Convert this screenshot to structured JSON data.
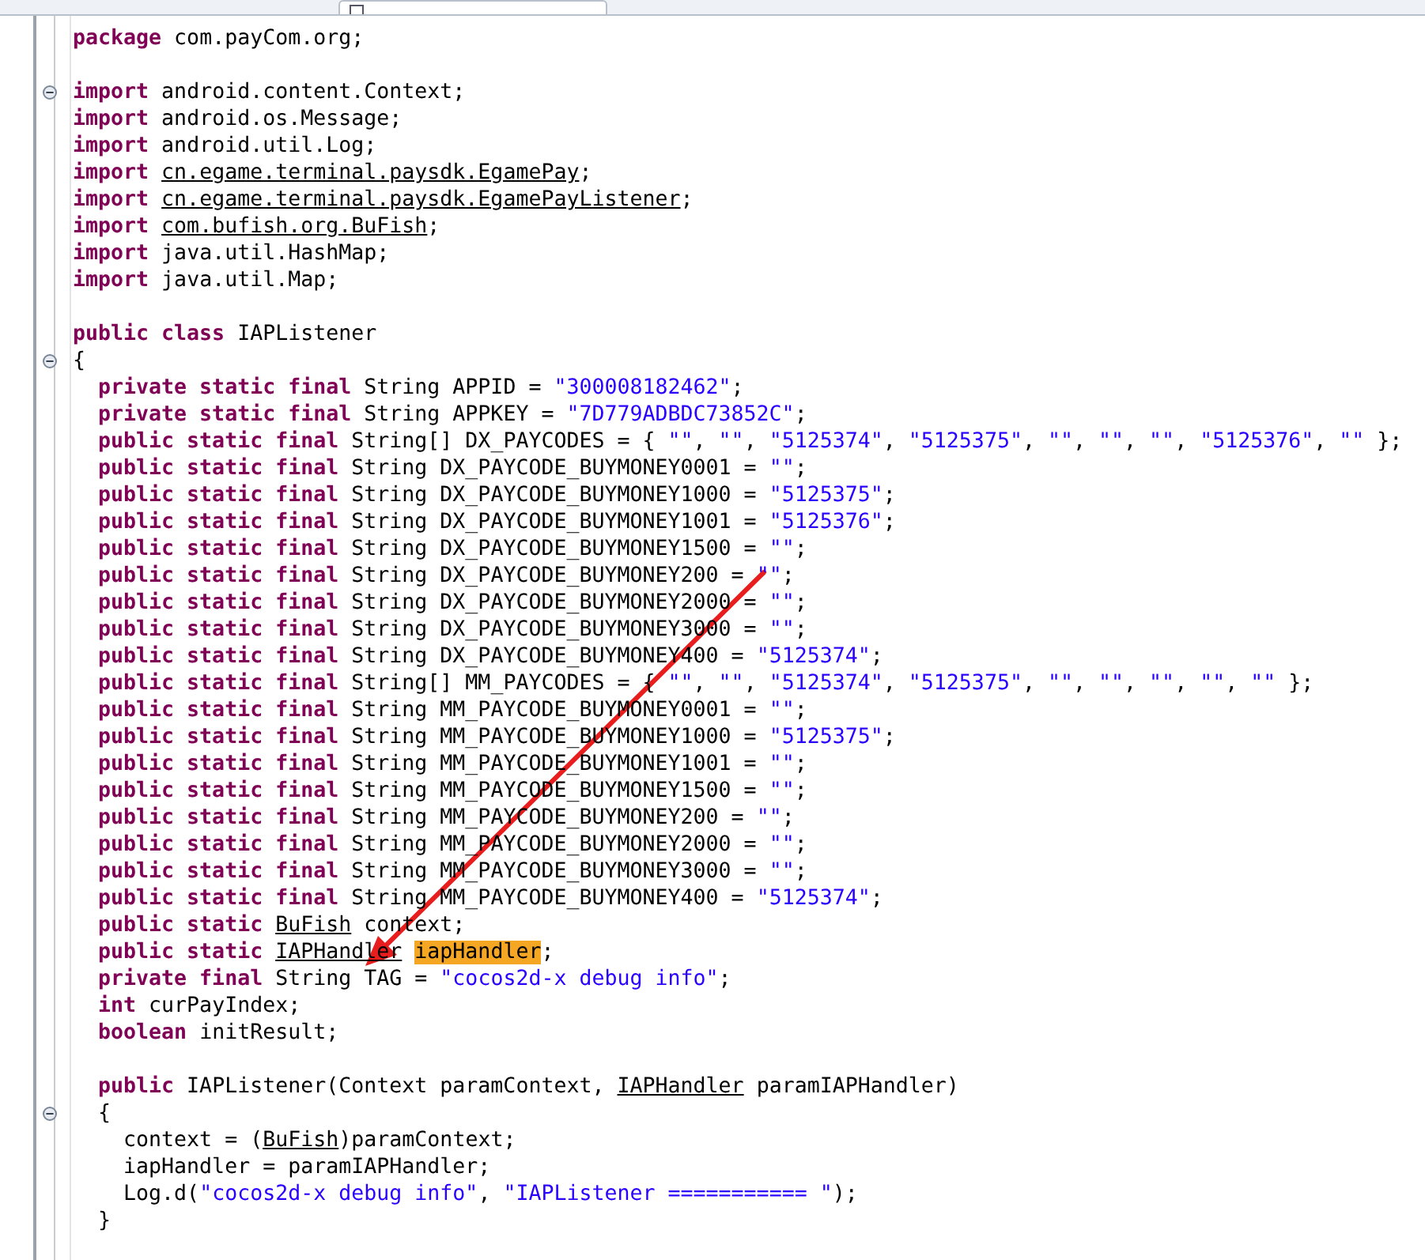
{
  "blocks": [
    [
      {
        "tokens": [
          {
            "kind": "kw",
            "text": "package"
          },
          {
            "kind": "t",
            "text": " com.payCom.org;"
          }
        ]
      }
    ],
    [
      {
        "kind": "fold",
        "expanded": true,
        "tokens": [
          {
            "kind": "kw",
            "text": "import"
          },
          {
            "kind": "t",
            "text": " android.content.Context;"
          }
        ]
      },
      {
        "tokens": [
          {
            "kind": "kw",
            "text": "import"
          },
          {
            "kind": "t",
            "text": " android.os.Message;"
          }
        ]
      },
      {
        "tokens": [
          {
            "kind": "kw",
            "text": "import"
          },
          {
            "kind": "t",
            "text": " android.util.Log;"
          }
        ]
      },
      {
        "tokens": [
          {
            "kind": "kw",
            "text": "import "
          },
          {
            "kind": "u",
            "text": "cn.egame.terminal.paysdk.EgamePay"
          },
          {
            "kind": "t",
            "text": ";"
          }
        ]
      },
      {
        "tokens": [
          {
            "kind": "kw",
            "text": "import "
          },
          {
            "kind": "u",
            "text": "cn.egame.terminal.paysdk.EgamePayListener"
          },
          {
            "kind": "t",
            "text": ";"
          }
        ]
      },
      {
        "tokens": [
          {
            "kind": "kw",
            "text": "import "
          },
          {
            "kind": "u",
            "text": "com.bufish.org.BuFish"
          },
          {
            "kind": "t",
            "text": ";"
          }
        ]
      },
      {
        "tokens": [
          {
            "kind": "kw",
            "text": "import"
          },
          {
            "kind": "t",
            "text": " java.util.HashMap;"
          }
        ]
      },
      {
        "tokens": [
          {
            "kind": "kw",
            "text": "import"
          },
          {
            "kind": "t",
            "text": " java.util.Map;"
          }
        ]
      }
    ],
    [
      {
        "tokens": [
          {
            "kind": "kw",
            "text": "public class"
          },
          {
            "kind": "t",
            "text": " IAPListener"
          }
        ]
      },
      {
        "kind": "fold",
        "expanded": true,
        "tokens": [
          {
            "kind": "t",
            "text": "{"
          }
        ]
      },
      {
        "tokens": [
          {
            "kind": "kw",
            "text": "  private static final"
          },
          {
            "kind": "t",
            "text": " String APPID = "
          },
          {
            "kind": "s",
            "text": "\"300008182462\""
          },
          {
            "kind": "t",
            "text": ";"
          }
        ]
      },
      {
        "tokens": [
          {
            "kind": "kw",
            "text": "  private static final"
          },
          {
            "kind": "t",
            "text": " String APPKEY = "
          },
          {
            "kind": "s",
            "text": "\"7D779ADBDC73852C\""
          },
          {
            "kind": "t",
            "text": ";"
          }
        ]
      },
      {
        "tokens": [
          {
            "kind": "kw",
            "text": "  public static final"
          },
          {
            "kind": "t",
            "text": " String[] DX_PAYCODES = { "
          },
          {
            "kind": "s",
            "text": "\"\""
          },
          {
            "kind": "t",
            "text": ", "
          },
          {
            "kind": "s",
            "text": "\"\""
          },
          {
            "kind": "t",
            "text": ", "
          },
          {
            "kind": "s",
            "text": "\"5125374\""
          },
          {
            "kind": "t",
            "text": ", "
          },
          {
            "kind": "s",
            "text": "\"5125375\""
          },
          {
            "kind": "t",
            "text": ", "
          },
          {
            "kind": "s",
            "text": "\"\""
          },
          {
            "kind": "t",
            "text": ", "
          },
          {
            "kind": "s",
            "text": "\"\""
          },
          {
            "kind": "t",
            "text": ", "
          },
          {
            "kind": "s",
            "text": "\"\""
          },
          {
            "kind": "t",
            "text": ", "
          },
          {
            "kind": "s",
            "text": "\"5125376\""
          },
          {
            "kind": "t",
            "text": ", "
          },
          {
            "kind": "s",
            "text": "\"\""
          },
          {
            "kind": "t",
            "text": " };"
          }
        ]
      },
      {
        "tokens": [
          {
            "kind": "kw",
            "text": "  public static final"
          },
          {
            "kind": "t",
            "text": " String DX_PAYCODE_BUYMONEY0001 = "
          },
          {
            "kind": "s",
            "text": "\"\""
          },
          {
            "kind": "t",
            "text": ";"
          }
        ]
      },
      {
        "tokens": [
          {
            "kind": "kw",
            "text": "  public static final"
          },
          {
            "kind": "t",
            "text": " String DX_PAYCODE_BUYMONEY1000 = "
          },
          {
            "kind": "s",
            "text": "\"5125375\""
          },
          {
            "kind": "t",
            "text": ";"
          }
        ]
      },
      {
        "tokens": [
          {
            "kind": "kw",
            "text": "  public static final"
          },
          {
            "kind": "t",
            "text": " String DX_PAYCODE_BUYMONEY1001 = "
          },
          {
            "kind": "s",
            "text": "\"5125376\""
          },
          {
            "kind": "t",
            "text": ";"
          }
        ]
      },
      {
        "tokens": [
          {
            "kind": "kw",
            "text": "  public static final"
          },
          {
            "kind": "t",
            "text": " String DX_PAYCODE_BUYMONEY1500 = "
          },
          {
            "kind": "s",
            "text": "\"\""
          },
          {
            "kind": "t",
            "text": ";"
          }
        ]
      },
      {
        "tokens": [
          {
            "kind": "kw",
            "text": "  public static final"
          },
          {
            "kind": "t",
            "text": " String DX_PAYCODE_BUYMONEY200 = "
          },
          {
            "kind": "s",
            "text": "\"\""
          },
          {
            "kind": "t",
            "text": ";"
          }
        ]
      },
      {
        "tokens": [
          {
            "kind": "kw",
            "text": "  public static final"
          },
          {
            "kind": "t",
            "text": " String DX_PAYCODE_BUYMONEY2000 = "
          },
          {
            "kind": "s",
            "text": "\"\""
          },
          {
            "kind": "t",
            "text": ";"
          }
        ]
      },
      {
        "tokens": [
          {
            "kind": "kw",
            "text": "  public static final"
          },
          {
            "kind": "t",
            "text": " String DX_PAYCODE_BUYMONEY3000 = "
          },
          {
            "kind": "s",
            "text": "\"\""
          },
          {
            "kind": "t",
            "text": ";"
          }
        ]
      },
      {
        "tokens": [
          {
            "kind": "kw",
            "text": "  public static final"
          },
          {
            "kind": "t",
            "text": " String DX_PAYCODE_BUYMONEY400 = "
          },
          {
            "kind": "s",
            "text": "\"5125374\""
          },
          {
            "kind": "t",
            "text": ";"
          }
        ]
      },
      {
        "tokens": [
          {
            "kind": "kw",
            "text": "  public static final"
          },
          {
            "kind": "t",
            "text": " String[] MM_PAYCODES = { "
          },
          {
            "kind": "s",
            "text": "\"\""
          },
          {
            "kind": "t",
            "text": ", "
          },
          {
            "kind": "s",
            "text": "\"\""
          },
          {
            "kind": "t",
            "text": ", "
          },
          {
            "kind": "s",
            "text": "\"5125374\""
          },
          {
            "kind": "t",
            "text": ", "
          },
          {
            "kind": "s",
            "text": "\"5125375\""
          },
          {
            "kind": "t",
            "text": ", "
          },
          {
            "kind": "s",
            "text": "\"\""
          },
          {
            "kind": "t",
            "text": ", "
          },
          {
            "kind": "s",
            "text": "\"\""
          },
          {
            "kind": "t",
            "text": ", "
          },
          {
            "kind": "s",
            "text": "\"\""
          },
          {
            "kind": "t",
            "text": ", "
          },
          {
            "kind": "s",
            "text": "\"\""
          },
          {
            "kind": "t",
            "text": ", "
          },
          {
            "kind": "s",
            "text": "\"\""
          },
          {
            "kind": "t",
            "text": " };"
          }
        ]
      },
      {
        "tokens": [
          {
            "kind": "kw",
            "text": "  public static final"
          },
          {
            "kind": "t",
            "text": " String MM_PAYCODE_BUYMONEY0001 = "
          },
          {
            "kind": "s",
            "text": "\"\""
          },
          {
            "kind": "t",
            "text": ";"
          }
        ]
      },
      {
        "tokens": [
          {
            "kind": "kw",
            "text": "  public static final"
          },
          {
            "kind": "t",
            "text": " String MM_PAYCODE_BUYMONEY1000 = "
          },
          {
            "kind": "s",
            "text": "\"5125375\""
          },
          {
            "kind": "t",
            "text": ";"
          }
        ]
      },
      {
        "tokens": [
          {
            "kind": "kw",
            "text": "  public static final"
          },
          {
            "kind": "t",
            "text": " String MM_PAYCODE_BUYMONEY1001 = "
          },
          {
            "kind": "s",
            "text": "\"\""
          },
          {
            "kind": "t",
            "text": ";"
          }
        ]
      },
      {
        "tokens": [
          {
            "kind": "kw",
            "text": "  public static final"
          },
          {
            "kind": "t",
            "text": " String MM_PAYCODE_BUYMONEY1500 = "
          },
          {
            "kind": "s",
            "text": "\"\""
          },
          {
            "kind": "t",
            "text": ";"
          }
        ]
      },
      {
        "tokens": [
          {
            "kind": "kw",
            "text": "  public static final"
          },
          {
            "kind": "t",
            "text": " String MM_PAYCODE_BUYMONEY200 = "
          },
          {
            "kind": "s",
            "text": "\"\""
          },
          {
            "kind": "t",
            "text": ";"
          }
        ]
      },
      {
        "tokens": [
          {
            "kind": "kw",
            "text": "  public static final"
          },
          {
            "kind": "t",
            "text": " String MM_PAYCODE_BUYMONEY2000 = "
          },
          {
            "kind": "s",
            "text": "\"\""
          },
          {
            "kind": "t",
            "text": ";"
          }
        ]
      },
      {
        "tokens": [
          {
            "kind": "kw",
            "text": "  public static final"
          },
          {
            "kind": "t",
            "text": " String MM_PAYCODE_BUYMONEY3000 = "
          },
          {
            "kind": "s",
            "text": "\"\""
          },
          {
            "kind": "t",
            "text": ";"
          }
        ]
      },
      {
        "tokens": [
          {
            "kind": "kw",
            "text": "  public static final"
          },
          {
            "kind": "t",
            "text": " String MM_PAYCODE_BUYMONEY400 = "
          },
          {
            "kind": "s",
            "text": "\"5125374\""
          },
          {
            "kind": "t",
            "text": ";"
          }
        ]
      },
      {
        "tokens": [
          {
            "kind": "kw",
            "text": "  public static "
          },
          {
            "kind": "u",
            "text": "BuFish"
          },
          {
            "kind": "t",
            "text": " context;"
          }
        ]
      },
      {
        "tokens": [
          {
            "kind": "kw",
            "text": "  public static "
          },
          {
            "kind": "u",
            "text": "IAPHandler",
            "gap": true
          },
          {
            "kind": "h",
            "text": "iapHandler"
          },
          {
            "kind": "t",
            "text": ";"
          }
        ]
      },
      {
        "tokens": [
          {
            "kind": "kw",
            "text": "  private final"
          },
          {
            "kind": "t",
            "text": " String TAG = "
          },
          {
            "kind": "s",
            "text": "\"cocos2d-x debug info\""
          },
          {
            "kind": "t",
            "text": ";"
          }
        ]
      },
      {
        "tokens": [
          {
            "kind": "kw",
            "text": "  int"
          },
          {
            "kind": "t",
            "text": " curPayIndex;"
          }
        ]
      },
      {
        "tokens": [
          {
            "kind": "kw",
            "text": "  boolean"
          },
          {
            "kind": "t",
            "text": " initResult;"
          }
        ]
      }
    ],
    [
      {
        "tokens": [
          {
            "kind": "kw",
            "text": "  public"
          },
          {
            "kind": "t",
            "text": " IAPListener(Context paramContext, "
          },
          {
            "kind": "u",
            "text": "IAPHandler"
          },
          {
            "kind": "t",
            "text": " paramIAPHandler)"
          }
        ]
      },
      {
        "kind": "fold",
        "expanded": true,
        "tokens": [
          {
            "kind": "t",
            "text": "  {"
          }
        ]
      },
      {
        "tokens": [
          {
            "kind": "t",
            "text": "    context = ("
          },
          {
            "kind": "u",
            "text": "BuFish"
          },
          {
            "kind": "t",
            "text": ")paramContext;"
          }
        ]
      },
      {
        "tokens": [
          {
            "kind": "t",
            "text": "    iapHandler = paramIAPHandler;"
          }
        ]
      },
      {
        "tokens": [
          {
            "kind": "t",
            "text": "    Log.d("
          },
          {
            "kind": "s",
            "text": "\"cocos2d-x debug info\""
          },
          {
            "kind": "t",
            "text": ", "
          },
          {
            "kind": "s",
            "text": "\"IAPListener =========== \""
          },
          {
            "kind": "t",
            "text": ");"
          }
        ]
      },
      {
        "tokens": [
          {
            "kind": "t",
            "text": "  }"
          }
        ]
      }
    ]
  ]
}
